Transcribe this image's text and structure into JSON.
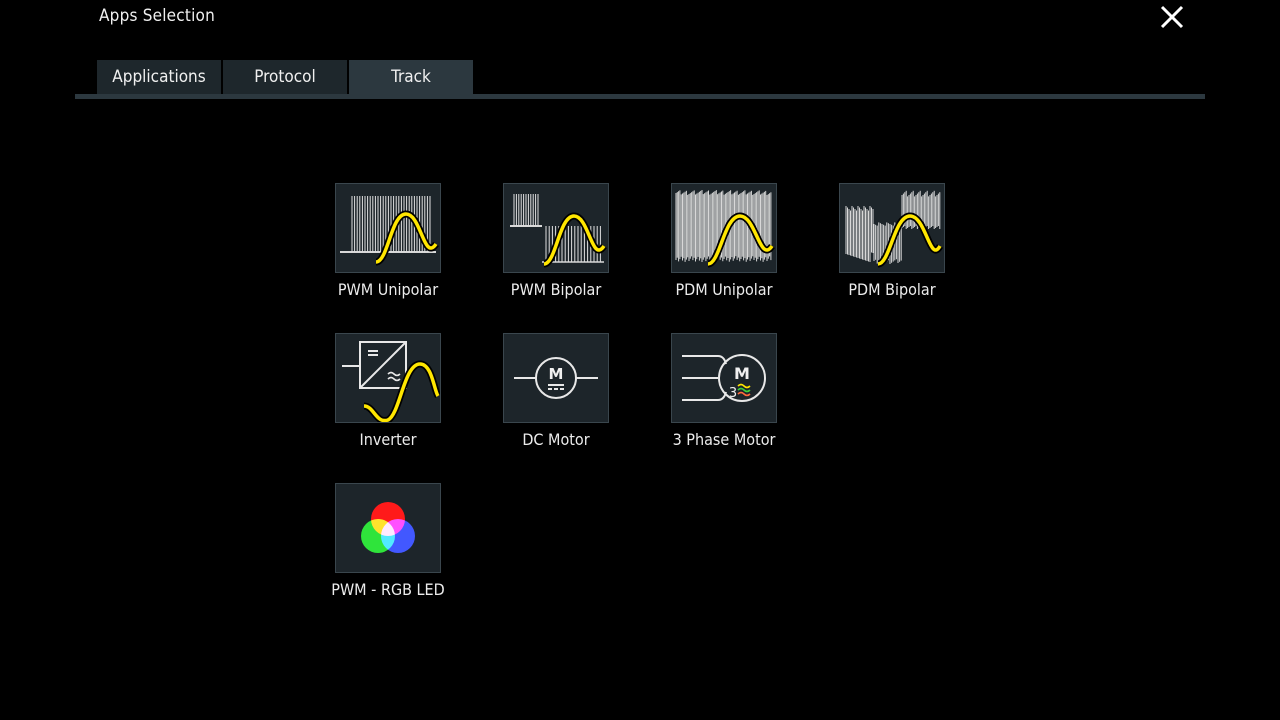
{
  "window": {
    "title": "Apps Selection"
  },
  "tabs": [
    {
      "label": "Applications",
      "active": false
    },
    {
      "label": "Protocol",
      "active": false
    },
    {
      "label": "Track",
      "active": true
    }
  ],
  "apps": [
    {
      "label": "PWM Unipolar",
      "icon": "pwm-unipolar-icon"
    },
    {
      "label": "PWM Bipolar",
      "icon": "pwm-bipolar-icon"
    },
    {
      "label": "PDM Unipolar",
      "icon": "pdm-unipolar-icon"
    },
    {
      "label": "PDM Bipolar",
      "icon": "pdm-bipolar-icon"
    },
    {
      "label": "Inverter",
      "icon": "inverter-icon"
    },
    {
      "label": "DC Motor",
      "icon": "dc-motor-icon"
    },
    {
      "label": "3 Phase Motor",
      "icon": "three-phase-motor-icon"
    },
    {
      "label": "PWM - RGB LED",
      "icon": "rgb-led-icon"
    }
  ],
  "icon_text": {
    "motor_letter": "M",
    "phase_number": "3"
  },
  "colors": {
    "background": "#000000",
    "tab_bg": "#1e272c",
    "tab_active_bg": "#2c383f",
    "tile_bg": "#1d252a",
    "sine_yellow": "#ffe600"
  }
}
